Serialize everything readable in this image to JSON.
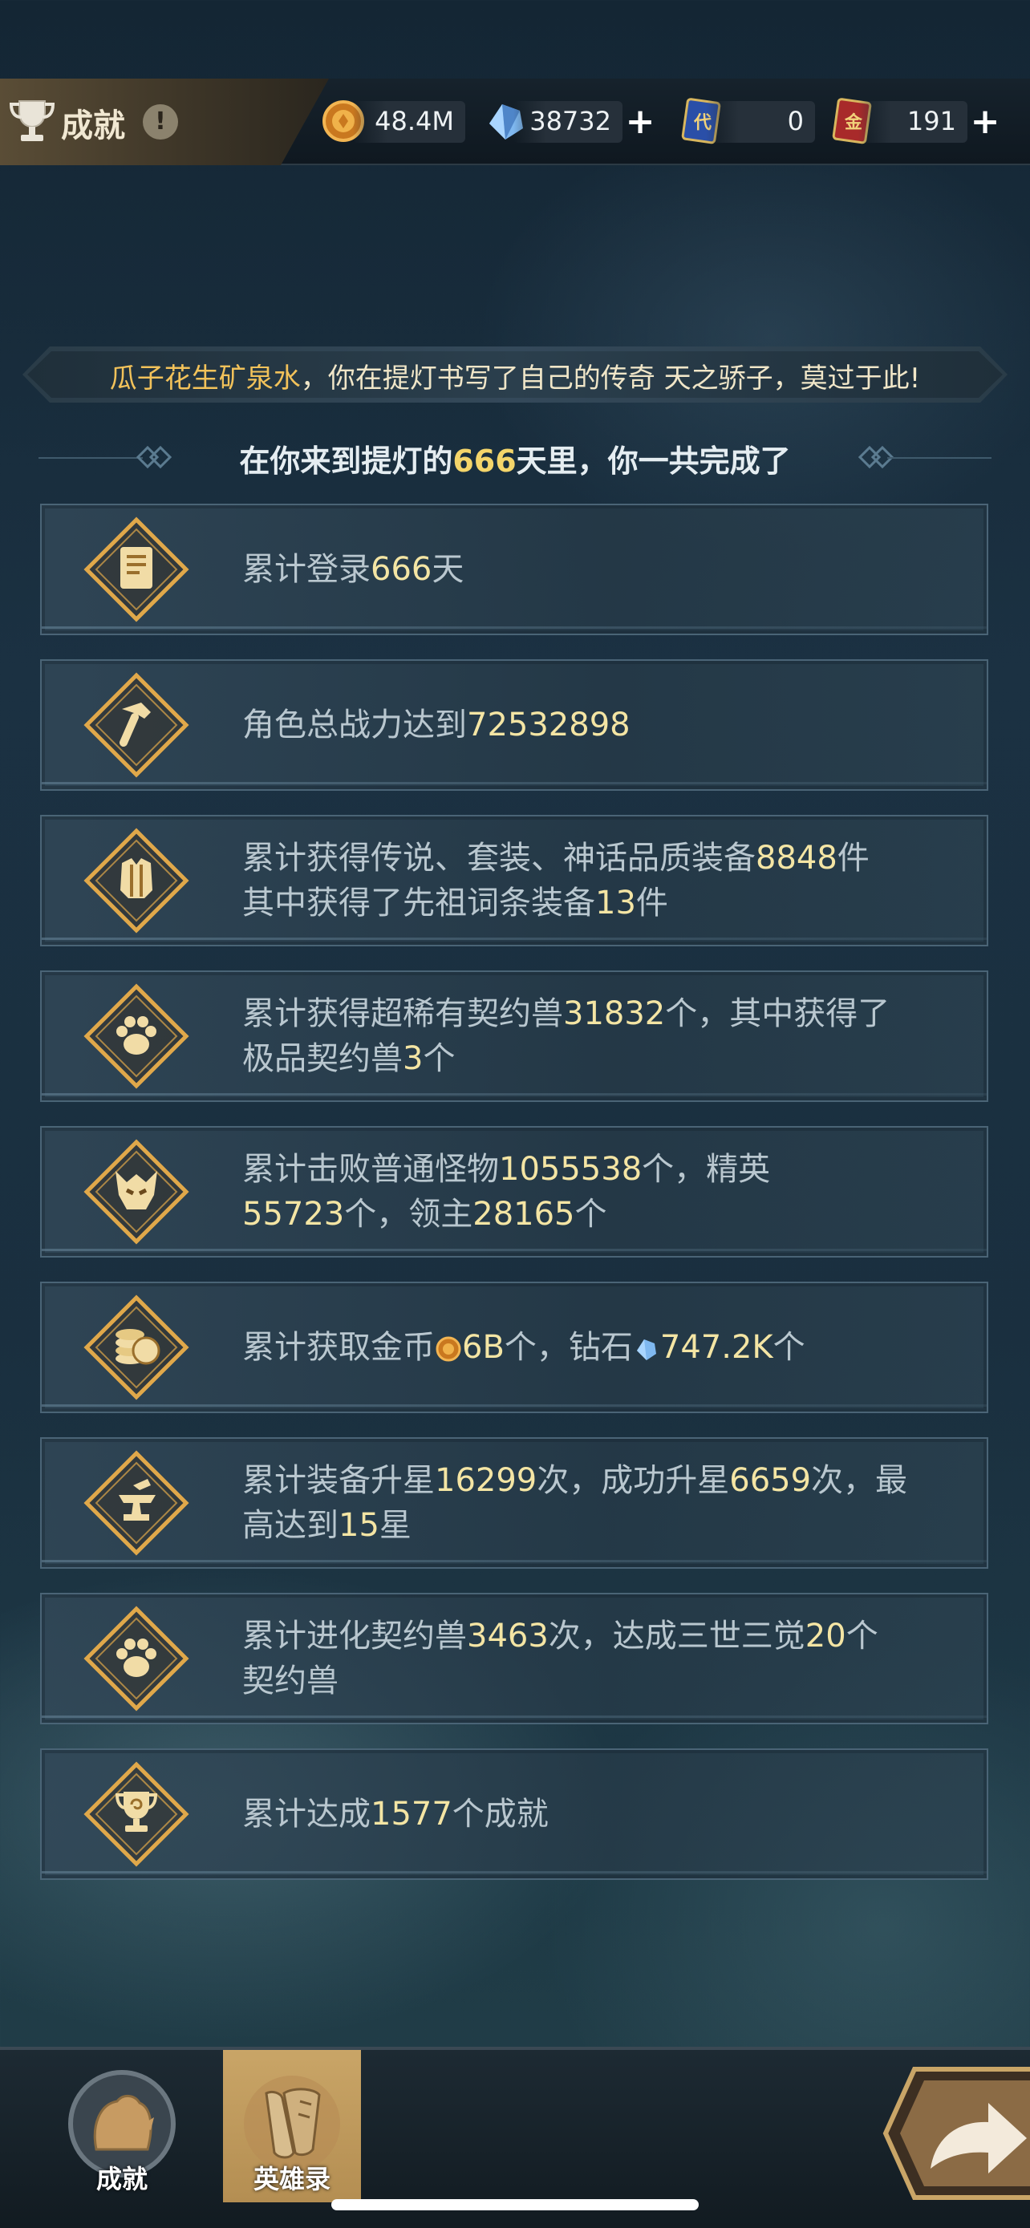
{
  "header": {
    "title": "成就",
    "info_icon": "!",
    "gold": "48.4M",
    "diamond": "38732",
    "ticket_blue": "0",
    "ticket_red": "191",
    "plus": "+"
  },
  "banner": {
    "name": "瓜子花生矿泉水",
    "text": "，你在提灯书写了自己的传奇 天之骄子，莫过于此!"
  },
  "subtitle": {
    "prefix": "在你来到提灯的",
    "days": "666",
    "suffix": "天里，你一共完成了"
  },
  "stats": [
    {
      "icon": "scroll-icon",
      "parts": [
        {
          "t": "累计登录"
        },
        {
          "t": "666",
          "hl": true
        },
        {
          "t": "天"
        }
      ]
    },
    {
      "icon": "hammer-icon",
      "parts": [
        {
          "t": "角色总战力达到"
        },
        {
          "t": "72532898",
          "hl": true
        }
      ]
    },
    {
      "icon": "armor-icon",
      "parts": [
        {
          "t": "累计获得传说、套装、神话品质装备"
        },
        {
          "t": "8848",
          "hl": true
        },
        {
          "t": "件"
        },
        {
          "br": true
        },
        {
          "t": "其中获得了先祖词条装备"
        },
        {
          "t": "13",
          "hl": true
        },
        {
          "t": "件"
        }
      ]
    },
    {
      "icon": "paw-icon",
      "parts": [
        {
          "t": "累计获得超稀有契约兽"
        },
        {
          "t": "31832",
          "hl": true
        },
        {
          "t": "个，其中获得了"
        },
        {
          "br": true
        },
        {
          "t": "极品契约兽"
        },
        {
          "t": "3",
          "hl": true
        },
        {
          "t": "个"
        }
      ]
    },
    {
      "icon": "monster-icon",
      "parts": [
        {
          "t": "累计击败普通怪物"
        },
        {
          "t": "1055538",
          "hl": true
        },
        {
          "t": "个，精英"
        },
        {
          "br": true
        },
        {
          "t": "55723",
          "hl": true
        },
        {
          "t": "个，领主"
        },
        {
          "t": "28165",
          "hl": true
        },
        {
          "t": "个"
        }
      ]
    },
    {
      "icon": "coins-icon",
      "parts": [
        {
          "t": "累计获取金币"
        },
        {
          "ico": "gold"
        },
        {
          "t": "6B",
          "hl": true
        },
        {
          "t": "个，钻石"
        },
        {
          "ico": "diamond"
        },
        {
          "t": "747.2K",
          "hl": true
        },
        {
          "t": "个"
        }
      ]
    },
    {
      "icon": "anvil-icon",
      "parts": [
        {
          "t": "累计装备升星"
        },
        {
          "t": "16299",
          "hl": true
        },
        {
          "t": "次，成功升星"
        },
        {
          "t": "6659",
          "hl": true
        },
        {
          "t": "次，最"
        },
        {
          "br": true
        },
        {
          "t": "高达到"
        },
        {
          "t": "15",
          "hl": true
        },
        {
          "t": "星"
        }
      ]
    },
    {
      "icon": "paw-icon",
      "parts": [
        {
          "t": "累计进化契约兽"
        },
        {
          "t": "3463",
          "hl": true
        },
        {
          "t": "次，达成三世三觉"
        },
        {
          "t": "20",
          "hl": true
        },
        {
          "t": "个"
        },
        {
          "br": true
        },
        {
          "t": "契约兽"
        }
      ]
    },
    {
      "icon": "trophy-icon",
      "parts": [
        {
          "t": "累计达成"
        },
        {
          "t": "1577",
          "hl": true
        },
        {
          "t": "个成就"
        }
      ]
    }
  ],
  "nav": {
    "tab1": "成就",
    "tab2": "英雄录"
  },
  "colors": {
    "highlight": "#f4e5a4",
    "name": "#f2c25a",
    "accent_gold": "#e0a84a"
  }
}
